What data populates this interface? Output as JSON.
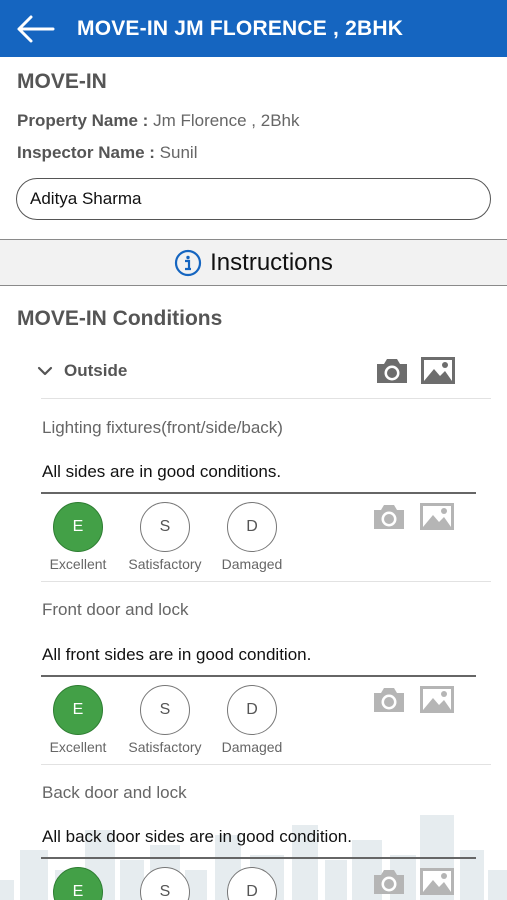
{
  "header": {
    "title": "MOVE-IN JM FLORENCE , 2BHK"
  },
  "section_title": "MOVE-IN",
  "property": {
    "label": "Property Name :",
    "value": "Jm Florence , 2Bhk"
  },
  "inspector": {
    "label": "Inspector Name :",
    "value": "Sunil"
  },
  "tenant_field": {
    "value": "Aditya Sharma"
  },
  "instructions": {
    "label": "Instructions"
  },
  "conditions_title": "MOVE-IN Conditions",
  "group": {
    "name": "Outside"
  },
  "items": [
    {
      "label": "Lighting fixtures(front/side/back)",
      "remark": "All sides are in good conditions.",
      "selected": "E"
    },
    {
      "label": "Front door and lock",
      "remark": "All front sides are in good condition.",
      "selected": "E"
    },
    {
      "label": "Back door and lock",
      "remark": "All back door sides are in good condition.",
      "selected": "E"
    }
  ],
  "ratings": [
    {
      "code": "E",
      "label": "Excellent"
    },
    {
      "code": "S",
      "label": "Satisfactory"
    },
    {
      "code": "D",
      "label": "Damaged"
    }
  ],
  "colors": {
    "appbar": "#1565c0",
    "selected": "#43a047",
    "icon_active": "#6d6d6d",
    "icon_muted": "#b5b5b5"
  },
  "icons": [
    "back-arrow-icon",
    "info-icon",
    "chevron-down-icon",
    "camera-icon",
    "gallery-icon"
  ]
}
